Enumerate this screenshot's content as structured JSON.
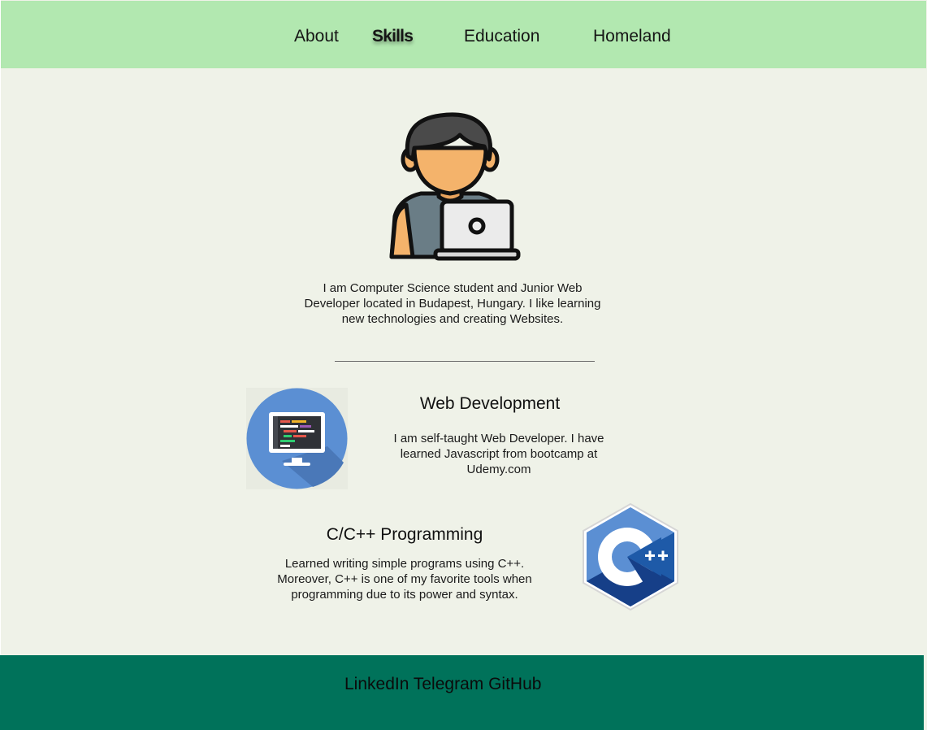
{
  "nav": {
    "items": [
      {
        "label": "About"
      },
      {
        "label": "Skills"
      },
      {
        "label": "Education"
      },
      {
        "label": "Homeland"
      }
    ]
  },
  "intro": {
    "avatar_icon": "developer-with-laptop-icon",
    "text": "I am Computer Science student and Junior Web Developer located in Budapest, Hungary. I like learning new technologies and creating Websites."
  },
  "skills": [
    {
      "title": "Web Development",
      "text": "I am self-taught Web Developer. I have learned Javascript from bootcamp at Udemy.com",
      "icon": "monitor-code-icon"
    },
    {
      "title": "C/C++ Programming",
      "text": "Learned writing simple programs using C++. Moreover, C++ is one of my favorite tools when programming due to its power and syntax.",
      "icon": "cpp-logo-icon"
    }
  ],
  "footer": {
    "links": [
      {
        "label": "LinkedIn"
      },
      {
        "label": "Telegram"
      },
      {
        "label": "GitHub"
      }
    ]
  },
  "colors": {
    "header_bg": "#b2e8b0",
    "page_bg": "#eff2e8",
    "footer_bg": "#00725a",
    "accent_blue": "#5b8fd3"
  }
}
